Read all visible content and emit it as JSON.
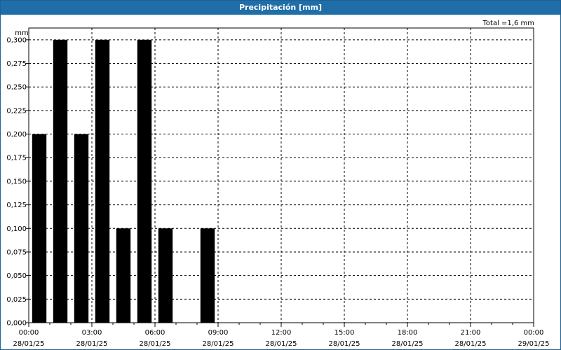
{
  "chart_data": {
    "type": "bar",
    "title": "Precipitación [mm]",
    "ylabel": "mm",
    "total_label": "Total =1,6 mm",
    "ylim": [
      0,
      0.3
    ],
    "y_ticks": [
      "0,000",
      "0,025",
      "0,050",
      "0,075",
      "0,100",
      "0,125",
      "0,150",
      "0,175",
      "0,200",
      "0,225",
      "0,250",
      "0,275",
      "0,300"
    ],
    "x_tick_labels": [
      [
        "00:00",
        "28/01/25"
      ],
      [
        "03:00",
        "28/01/25"
      ],
      [
        "06:00",
        "28/01/25"
      ],
      [
        "09:00",
        "28/01/25"
      ],
      [
        "12:00",
        "28/01/25"
      ],
      [
        "15:00",
        "28/01/25"
      ],
      [
        "18:00",
        "28/01/25"
      ],
      [
        "21:00",
        "28/01/25"
      ],
      [
        "00:00",
        "29/01/25"
      ]
    ],
    "x_range_hours": [
      0,
      24
    ],
    "bars_hour": [
      0,
      1,
      2,
      3,
      4,
      5,
      6,
      7,
      8
    ],
    "values": [
      0.2,
      0.3,
      0.2,
      0.3,
      0.1,
      0.3,
      0.1,
      0,
      0.1
    ],
    "bar_color": "#000000",
    "grid": true
  }
}
